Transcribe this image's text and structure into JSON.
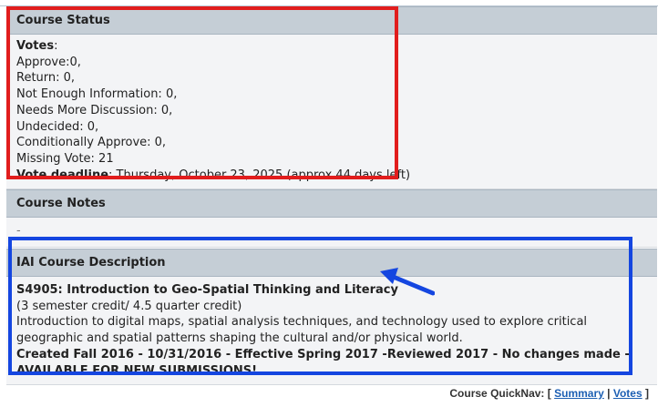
{
  "course_status": {
    "header": "Course Status",
    "votes_label": "Votes",
    "votes_colon": ":",
    "lines": [
      "Approve:0,",
      "Return: 0,",
      "Not Enough Information: 0,",
      "Needs More Discussion: 0,",
      "Undecided: 0,",
      "Conditionally Approve: 0,",
      "Missing Vote: 21"
    ],
    "deadline_label": "Vote deadline",
    "deadline_value": ": Thursday, October 23, 2025 (approx 44 days left)"
  },
  "course_notes": {
    "header": "Course Notes",
    "value": "-"
  },
  "iai_description": {
    "header": "IAI Course Description",
    "title": "S4905: Introduction to Geo-Spatial Thinking and Literacy",
    "credit": "(3 semester credit/ 4.5 quarter credit)",
    "description": "Introduction to digital maps, spatial analysis techniques, and technology used to explore critical geographic and spatial patterns shaping the cultural and/or physical world.",
    "history": "Created Fall 2016 - 10/31/2016 - Effective Spring 2017 -Reviewed 2017 - No changes made - AVAILABLE FOR NEW SUBMISSIONS!"
  },
  "quicknav": {
    "prefix": "Course QuickNav: [",
    "summary": "Summary",
    "separator": "|",
    "votes": "Votes",
    "suffix": "]"
  },
  "colors": {
    "highlight_red": "#e11d1d",
    "highlight_blue": "#1446e0",
    "header_bg": "#c5ced6",
    "link": "#1c5fb3"
  }
}
